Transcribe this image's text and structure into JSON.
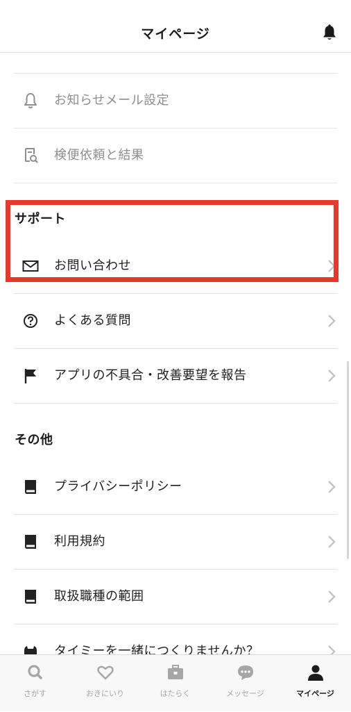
{
  "header": {
    "title": "マイページ"
  },
  "menu": {
    "notify_mail": "お知らせメール設定",
    "inspection": "検便依頼と結果",
    "support_heading": "サポート",
    "contact": "お問い合わせ",
    "faq": "よくある質問",
    "report_bug": "アプリの不具合・改善要望を報告",
    "others_heading": "その他",
    "privacy": "プライバシーポリシー",
    "terms": "利用規約",
    "job_scope": "取扱職種の範囲",
    "recruit": "タイミーを一緒につくりませんか？"
  },
  "tabs": [
    {
      "label": "さがす",
      "icon": "search-icon"
    },
    {
      "label": "おきにいり",
      "icon": "heart-icon"
    },
    {
      "label": "はたらく",
      "icon": "briefcase-icon"
    },
    {
      "label": "メッセージ",
      "icon": "chat-bubble-icon"
    },
    {
      "label": "マイページ",
      "icon": "person-icon"
    }
  ],
  "colors": {
    "highlight": "#e6392b",
    "muted_text": "#8e8e8e",
    "tab_inactive": "#a6a6a6",
    "tab_active": "#1c1c1c"
  },
  "active_tab": "マイページ"
}
